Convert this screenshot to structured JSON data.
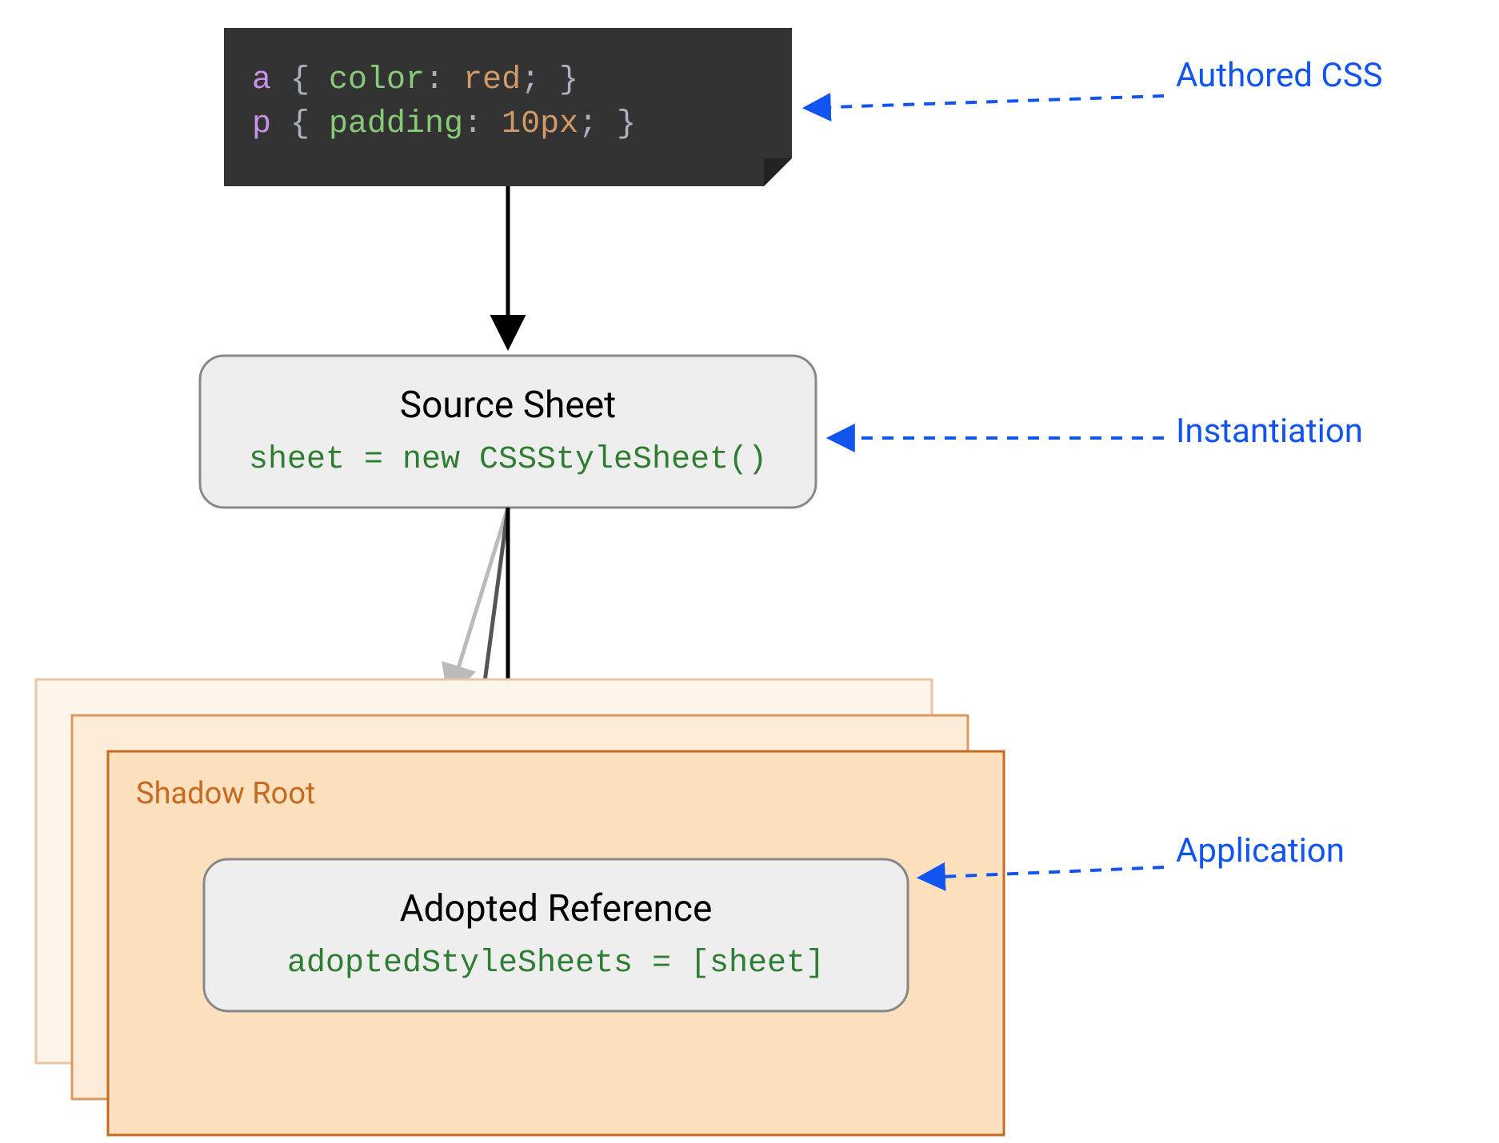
{
  "code_block": {
    "lines": [
      {
        "selector": "a",
        "brace_open": " { ",
        "prop": "color",
        "colon": ": ",
        "value": "red",
        "after": "; }"
      },
      {
        "selector": "p",
        "brace_open": " { ",
        "prop": "padding",
        "colon": ": ",
        "value": "10px",
        "after": "; }"
      }
    ]
  },
  "source_sheet": {
    "title": "Source Sheet",
    "code": "sheet = new CSSStyleSheet()"
  },
  "shadow_root": {
    "label": "Shadow Root"
  },
  "adopted_reference": {
    "title": "Adopted Reference",
    "code": "adoptedStyleSheets = [sheet]"
  },
  "annotations": {
    "authored": "Authored CSS",
    "instantiation": "Instantiation",
    "application": "Application"
  },
  "colors": {
    "code_bg": "#333333",
    "code_selector": "#c792ea",
    "code_brace": "#abb2bf",
    "code_prop": "#89ca78",
    "code_value": "#c59a6a",
    "code_value2": "#c59a6a",
    "box_bg": "#eeeeee",
    "box_border": "#888888",
    "shadow_bg": "#fde0bd",
    "shadow_bg_faded1": "#fdecd8",
    "shadow_bg_faded2": "#fef5eb",
    "shadow_border": "#c76a1f",
    "shadow_border_faded1": "#d89a61",
    "shadow_border_faded2": "#e8c5a3",
    "anno_blue": "#1155ee",
    "arrow_black": "#000000",
    "arrow_gray1": "#555555",
    "arrow_gray2": "#bbbbbb",
    "code_green": "#2e7d32"
  }
}
